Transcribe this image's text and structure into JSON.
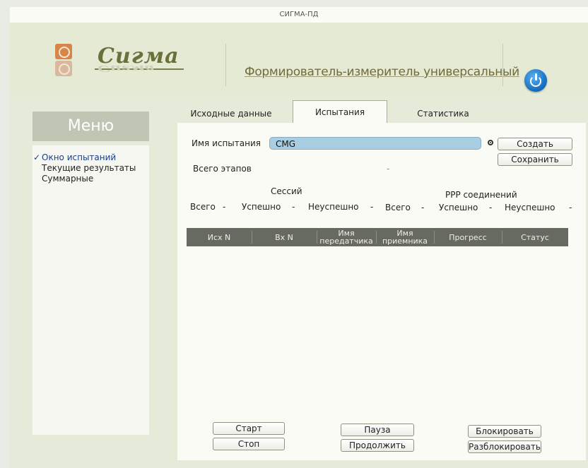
{
  "window": {
    "title": "СИГМА-ПД"
  },
  "header": {
    "logo_text": "Сигма",
    "app_title": "Формирователь-измеритель универсальный",
    "icons": {
      "logo": "sigma-logo-icon",
      "power": "power-icon"
    }
  },
  "sidebar": {
    "title": "Меню",
    "items": [
      {
        "label": "Окно испытаний",
        "active": true
      },
      {
        "label": "Текущие результаты",
        "active": false
      },
      {
        "label": "Суммарные",
        "active": false
      }
    ]
  },
  "tabs": [
    {
      "label": "Исходные данные",
      "active": false
    },
    {
      "label": "Испытания",
      "active": true
    },
    {
      "label": "Статистика",
      "active": false
    }
  ],
  "test": {
    "name_label": "Имя испытания",
    "name_value": "CMG",
    "create_label": "Создать",
    "save_label": "Сохранить",
    "stages_label": "Всего этапов",
    "stages_value": "-"
  },
  "sessions": {
    "title": "Сессий",
    "total_label": "Всего",
    "total_value": "-",
    "success_label": "Успешно",
    "success_value": "-",
    "fail_label": "Неуспешно",
    "fail_value": "-"
  },
  "ppp": {
    "title": "PPP соединений",
    "total_label": "Всего",
    "total_value": "-",
    "success_label": "Успешно",
    "success_value": "-",
    "fail_label": "Неуспешно",
    "fail_value": "-"
  },
  "table": {
    "columns": [
      "Исх N",
      "Вх N",
      "Имя передатчика",
      "Имя приемника",
      "Прогресс",
      "Статус"
    ],
    "rows": []
  },
  "controls": {
    "start": "Старт",
    "stop": "Стоп",
    "pause": "Пауза",
    "resume": "Продолжить",
    "lock": "Блокировать",
    "unlock": "Разблокировать"
  },
  "colors": {
    "accent": "#a9cde1",
    "header_bg": "#666a61",
    "menu_bg": "#bfc6b3",
    "power": "#1369be"
  }
}
